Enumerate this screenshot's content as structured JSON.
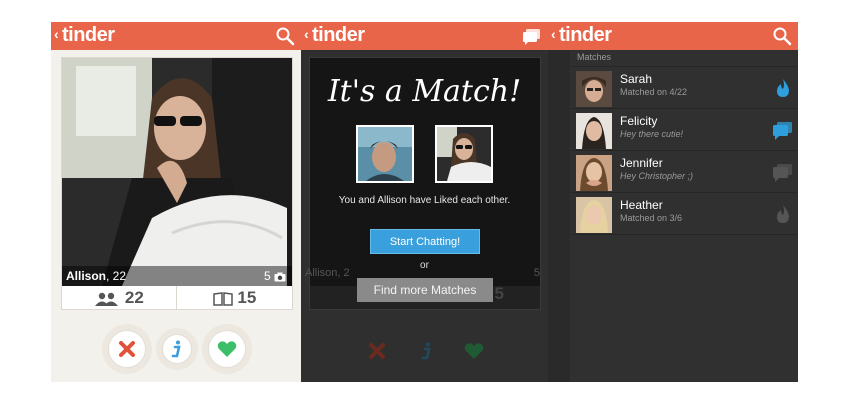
{
  "brand": "tinder",
  "back_glyph": "‹",
  "colors": {
    "header": "#e8654a",
    "accent_blue": "#3aa0dd",
    "like_green": "#3dbf6a",
    "nope_red": "#e0533a"
  },
  "screen1": {
    "profile": {
      "name": "Allison",
      "age": ", 22",
      "photo_count": "5"
    },
    "stats": {
      "friends": "22",
      "interests": "15"
    },
    "icons": [
      "search-icon",
      "camera-icon",
      "friends-icon",
      "book-icon",
      "nope-icon",
      "info-icon",
      "like-icon"
    ]
  },
  "screen2": {
    "title": "It's a Match!",
    "subtitle": "You and Allison have Liked each other.",
    "start_chatting": "Start Chatting!",
    "or": "or",
    "find_more": "Find more Matches",
    "bg_name": "Allison, 2",
    "bg_photo_count": "5",
    "bg_stat_right": "5"
  },
  "screen3": {
    "section_label": "Matches",
    "matches": [
      {
        "name": "Sarah",
        "status": "Matched on 4/22",
        "icon": "flame-icon"
      },
      {
        "name": "Felicity",
        "status": "Hey there cutie!",
        "icon": "chat-icon"
      },
      {
        "name": "Jennifer",
        "status": "Hey Christopher ;)",
        "icon": "chat-icon"
      },
      {
        "name": "Heather",
        "status": "Matched on 3/6",
        "icon": "flame-icon"
      }
    ]
  }
}
